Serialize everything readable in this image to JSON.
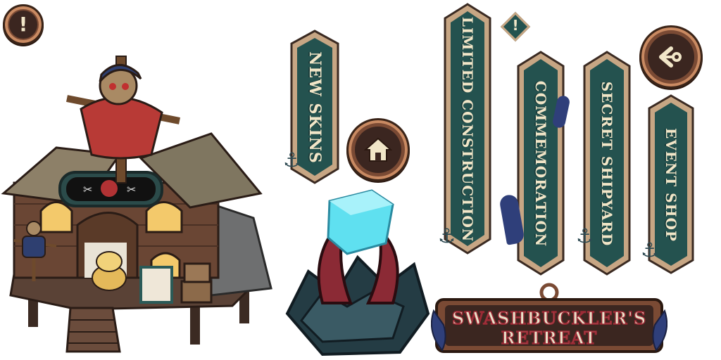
{
  "banners": {
    "new_skins": "NEW SKINS",
    "limited_construction": "LIMITED CONSTRUCTION",
    "commemoration": "COMMEMORATION",
    "secret_shipyard": "SECRET SHIPYARD",
    "event_shop": "EVENT SHOP"
  },
  "title_sign": {
    "line1": "SWASHBUCKLER'S",
    "line2": "RETREAT"
  },
  "icons": {
    "alert_round": "exclamation-icon",
    "alert_diamond": "exclamation-icon",
    "home": "home-icon",
    "back": "anchor-back-icon"
  },
  "colors": {
    "banner_teal": "#24524f",
    "banner_border": "#c7a684",
    "wood_brown": "#7a4a34",
    "title_red": "#9b2a35",
    "crystal_cyan": "#5fe0f0"
  }
}
